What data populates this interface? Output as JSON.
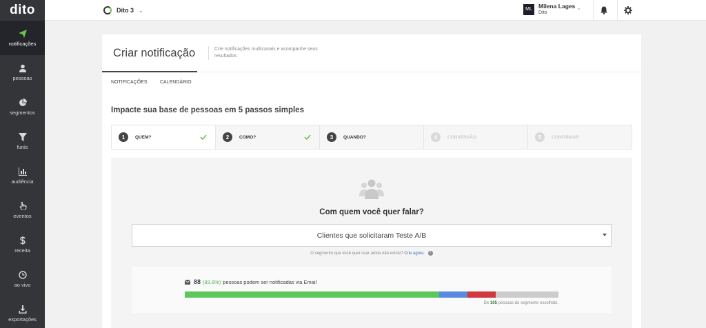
{
  "sidebar": {
    "logo": "dito",
    "items": [
      {
        "label": "notificações",
        "icon": "paper-plane-icon",
        "active": true
      },
      {
        "label": "pessoas",
        "icon": "person-icon"
      },
      {
        "label": "segmentos",
        "icon": "pie-chart-icon"
      },
      {
        "label": "funis",
        "icon": "funnel-icon"
      },
      {
        "label": "audiência",
        "icon": "bar-chart-icon"
      },
      {
        "label": "eventos",
        "icon": "pointer-hand-icon"
      },
      {
        "label": "receita",
        "icon": "dollar-icon"
      },
      {
        "label": "ao vivo",
        "icon": "clock-icon"
      },
      {
        "label": "exportações",
        "icon": "download-icon"
      }
    ]
  },
  "topbar": {
    "account_name": "Dito 3",
    "user_initials": "ML",
    "user_name": "Milena Lages",
    "user_org": "Dito",
    "icons": [
      "bell-icon",
      "gear-icon"
    ]
  },
  "header": {
    "title": "Criar notificação",
    "description": "Crie notificações multicanais e acompanhe seus resultados",
    "tabs": [
      "NOTIFICAÇÕES",
      "CALENDÁRIO"
    ]
  },
  "main": {
    "heading": "Impacte sua base de pessoas em 5 passos simples",
    "steps": [
      {
        "num": "1",
        "label": "QUEM?",
        "done": true
      },
      {
        "num": "2",
        "label": "COMO?",
        "done": true
      },
      {
        "num": "3",
        "label": "QUANDO?",
        "done": false
      },
      {
        "num": "4",
        "label": "CONVERSÃO",
        "done": false
      },
      {
        "num": "5",
        "label": "CONFIRMAR",
        "done": false
      }
    ],
    "question": "Com quem você quer falar?",
    "segment_selected": "Clientes que solicitaram Teste A/B",
    "hint_text": "O segmento que você quer usar ainda não existe?",
    "hint_link": "Crie agora.",
    "hint_info": "i",
    "stats": {
      "count": "88",
      "percent": "(83.8%)",
      "text": "pessoas podem ser notificadas via Email",
      "note_prefix": "De",
      "total": "105",
      "note_suffix": "pessoas do segmento escolhido.",
      "bar": [
        {
          "color": "#5cc85c",
          "fraction": 0.68
        },
        {
          "color": "#5b8be0",
          "fraction": 0.076
        },
        {
          "color": "#d03a3f",
          "fraction": 0.076
        },
        {
          "color": "#cccccc",
          "fraction": 0.168
        }
      ]
    }
  }
}
